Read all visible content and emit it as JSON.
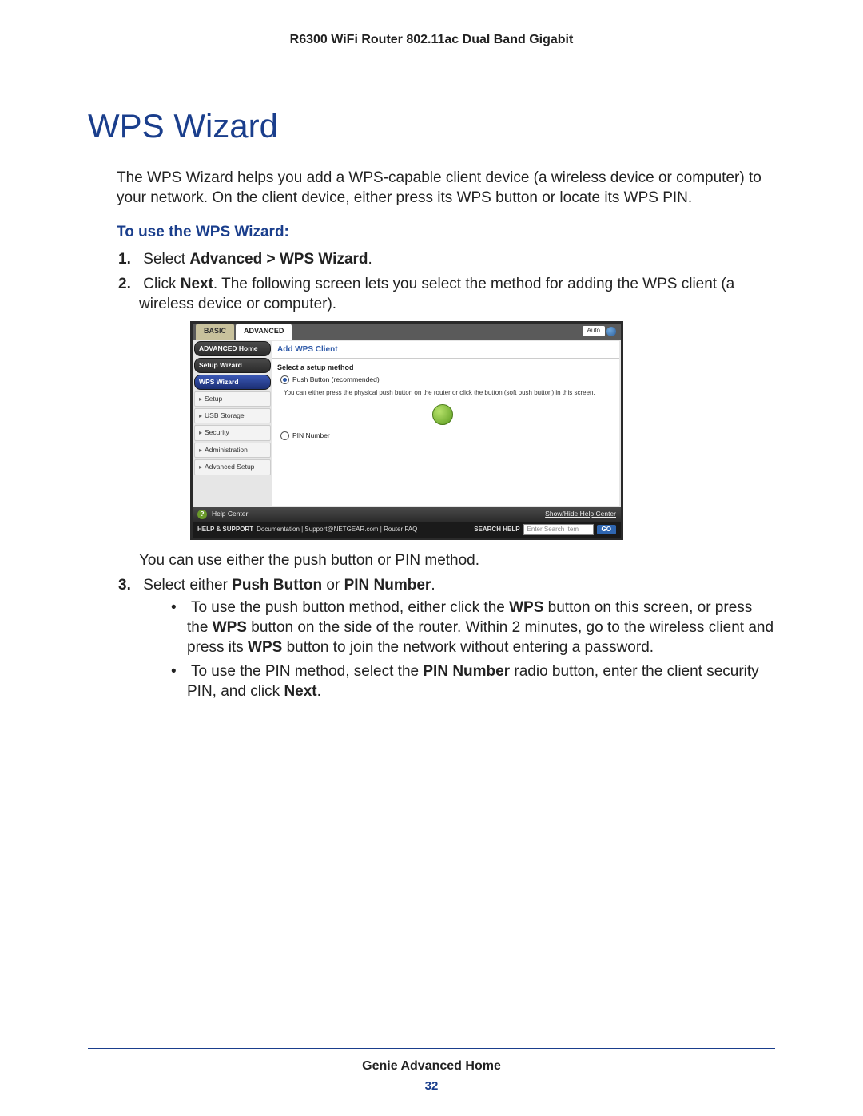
{
  "header": {
    "running_head": "R6300 WiFi Router 802.11ac Dual Band Gigabit"
  },
  "title": "WPS Wizard",
  "intro": "The WPS Wizard helps you add a WPS-capable client device (a wireless device or computer) to your network. On the client device, either press its WPS button or locate its WPS PIN.",
  "sub_heading": "To use the WPS Wizard:",
  "steps": {
    "s1_pre": "Select ",
    "s1_bold": "Advanced > WPS Wizard",
    "s1_post": ".",
    "s2_pre": "Click ",
    "s2_bold": "Next",
    "s2_post": ". The following screen lets you select the method for adding the WPS client (a wireless device or computer).",
    "after_shot": "You can use either the push button or PIN method.",
    "s3_pre": "Select either ",
    "s3_b1": "Push Button",
    "s3_mid": " or ",
    "s3_b2": "PIN Number",
    "s3_post": "."
  },
  "bullets": {
    "b1": "To use the push button method, either click the ",
    "b1b1": "WPS",
    "b1m1": " button on this screen, or press the ",
    "b1b2": "WPS",
    "b1m2": " button on the side of the router. Within 2 minutes, go to the wireless client and press its ",
    "b1b3": "WPS",
    "b1m3": " button to join the network without entering a password.",
    "b2": "To use the PIN method, select the ",
    "b2b1": "PIN Number",
    "b2m1": " radio button, enter the client security PIN, and click ",
    "b2b2": "Next",
    "b2m2": "."
  },
  "router_ui": {
    "tabs": {
      "basic": "BASIC",
      "advanced": "ADVANCED",
      "auto": "Auto"
    },
    "sidebar": {
      "home": "ADVANCED Home",
      "setup_wizard": "Setup Wizard",
      "wps_wizard": "WPS Wizard",
      "setup": "Setup",
      "usb": "USB Storage",
      "security": "Security",
      "admin": "Administration",
      "adv": "Advanced Setup"
    },
    "content": {
      "title": "Add WPS Client",
      "select_method": "Select a setup method",
      "push_button": "Push Button (recommended)",
      "note": "You can either press the physical push button on the router or click the button (soft push button) in this screen.",
      "pin": "PIN Number"
    },
    "help_bar": {
      "label": "Help Center",
      "toggle": "Show/Hide Help Center"
    },
    "support": {
      "label": "HELP & SUPPORT",
      "links": "Documentation | Support@NETGEAR.com | Router FAQ",
      "search_label": "SEARCH HELP",
      "placeholder": "Enter Search Item",
      "go": "GO"
    }
  },
  "footer": {
    "title": "Genie Advanced Home",
    "page": "32"
  }
}
